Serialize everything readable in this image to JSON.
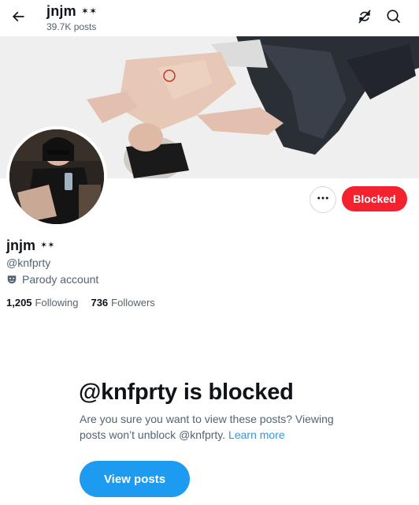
{
  "header": {
    "display_name": "jnjm",
    "name_emoji": "✶✶",
    "post_count": "39.7K posts",
    "back_icon": "arrow-left-icon",
    "sync_icon": "sync-off-icon",
    "search_icon": "search-icon"
  },
  "profile": {
    "display_name": "jnjm",
    "name_emoji": "✶✶",
    "handle": "@knfprty",
    "parody_label": "Parody account",
    "following_count": "1,205",
    "following_label": "Following",
    "followers_count": "736",
    "followers_label": "Followers"
  },
  "actions": {
    "more_icon": "more-horizontal-icon",
    "blocked_label": "Blocked"
  },
  "blocked_notice": {
    "title": "@knfprty is blocked",
    "description": "Are you sure you want to view these posts? Viewing posts won’t unblock @knfprty.",
    "learn_more": "Learn more",
    "view_posts_label": "View posts"
  },
  "colors": {
    "accent": "#1d9bf0",
    "blocked": "#f4212e",
    "text_primary": "#0f1419",
    "text_secondary": "#536471"
  }
}
